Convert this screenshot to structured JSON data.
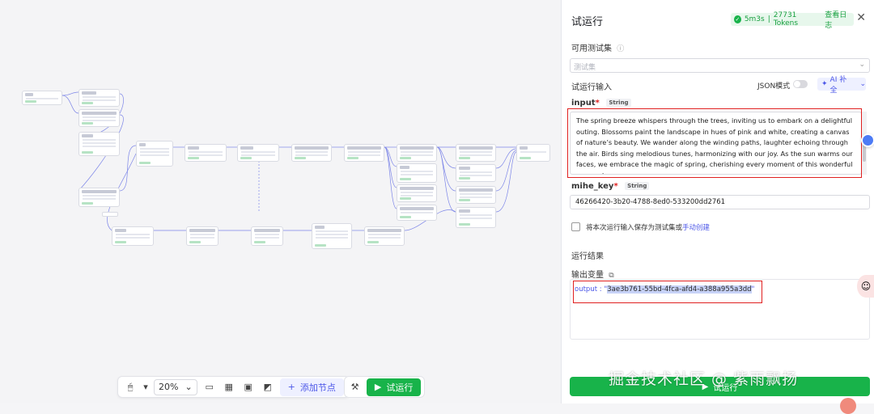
{
  "panel": {
    "title": "试运行",
    "status": {
      "duration": "5m3s",
      "tokens": "27731 Tokens",
      "view_log": "查看日志"
    },
    "testset_label": "可用测试集",
    "testset_placeholder": "测试集",
    "run_input_label": "试运行输入",
    "json_mode_label": "JSON模式",
    "ai_fill_label": "AI 补全",
    "input_name": "input",
    "input_type": "String",
    "input_value": "The spring breeze whispers through the trees, inviting us to embark on a delightful outing. Blossoms paint the landscape in hues of pink and white, creating a canvas of nature’s beauty. We wander along the winding paths, laughter echoing through the air. Birds sing melodious tunes, harmonizing with our joy. As the sun warms our faces, we embrace the magic of spring, cherishing every moment of this wonderful escapade",
    "key_name": "mihe_key",
    "key_type": "String",
    "key_value": "46266420-3b20-4788-8ed0-533200dd2761",
    "save_text": "将本次运行输入保存为测试集或",
    "save_link": "手动创建",
    "result_label": "运行结果",
    "output_var_label": "输出变量",
    "output_key": "output",
    "output_value": "3ae3b761-55bd-4fca-afd4-a388a955a3dd",
    "bottom_run_label": "试运行"
  },
  "toolbar": {
    "zoom": "20%",
    "add_node": "添加节点",
    "run": "试运行"
  },
  "watermark": "掘金技术社区 @ 紫雨飘扬",
  "colors": {
    "accent": "#4c57e8",
    "run_green": "#18b34a",
    "highlight_red": "#e02020"
  }
}
